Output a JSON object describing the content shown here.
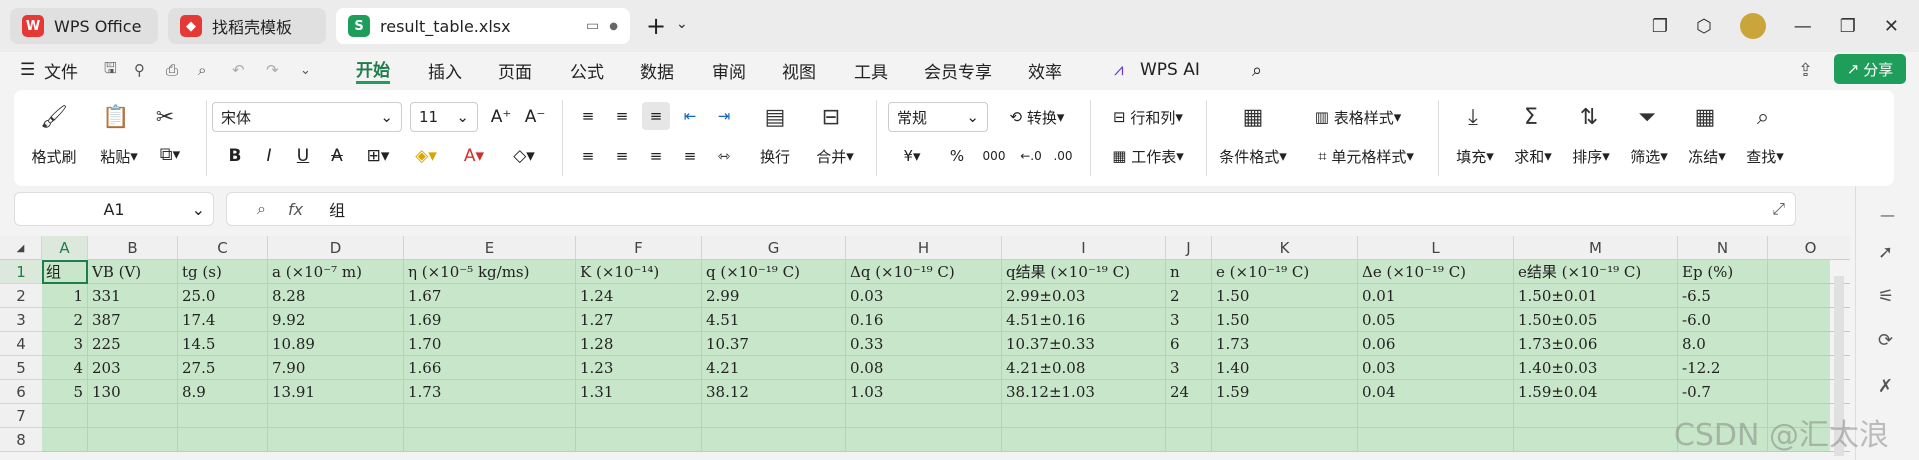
{
  "tabs": [
    {
      "label": "WPS Office"
    },
    {
      "label": "找稻壳模板"
    },
    {
      "label": "result_table.xlsx"
    }
  ],
  "menu": {
    "file": "文件",
    "items": [
      "开始",
      "插入",
      "页面",
      "公式",
      "数据",
      "审阅",
      "视图",
      "工具",
      "会员专享",
      "效率"
    ],
    "wps_ai": "WPS AI",
    "share": "分享"
  },
  "ribbon": {
    "format_painter": "格式刷",
    "paste": "粘贴",
    "font": "宋体",
    "size": "11",
    "number_format": "常规",
    "convert": "转换",
    "row_col": "行和列",
    "wrap": "换行",
    "merge": "合并",
    "worksheet": "工作表",
    "cond_format": "条件格式",
    "table_style": "表格样式",
    "cell_style": "单元格样式",
    "fill": "填充",
    "sum": "求和",
    "sort": "排序",
    "filter": "筛选",
    "freeze": "冻结",
    "find": "查找",
    "currency": "¥",
    "percent": "%",
    "thousands": "000"
  },
  "formula_bar": {
    "name_box": "A1",
    "fx": "fx",
    "content": "组"
  },
  "columns": [
    "A",
    "B",
    "C",
    "D",
    "E",
    "F",
    "G",
    "H",
    "I",
    "J",
    "K",
    "L",
    "M",
    "N",
    "O"
  ],
  "rows": [
    [
      "组",
      "VB (V)",
      "tg (s)",
      "a (×10⁻⁷ m)",
      "η (×10⁻⁵ kg/ms)",
      "K (×10⁻¹⁴)",
      "q (×10⁻¹⁹ C)",
      "Δq (×10⁻¹⁹ C)",
      "q结果 (×10⁻¹⁹ C)",
      "n",
      "e (×10⁻¹⁹ C)",
      "Δe (×10⁻¹⁹ C)",
      "e结果 (×10⁻¹⁹ C)",
      "Ep (%)",
      ""
    ],
    [
      "1",
      "331",
      "25.0",
      "8.28",
      "1.67",
      "1.24",
      "2.99",
      "0.03",
      "2.99±0.03",
      "2",
      "1.50",
      "0.01",
      "1.50±0.01",
      "-6.5",
      ""
    ],
    [
      "2",
      "387",
      "17.4",
      "9.92",
      "1.69",
      "1.27",
      "4.51",
      "0.16",
      "4.51±0.16",
      "3",
      "1.50",
      "0.05",
      "1.50±0.05",
      "-6.0",
      ""
    ],
    [
      "3",
      "225",
      "14.5",
      "10.89",
      "1.70",
      "1.28",
      "10.37",
      "0.33",
      "10.37±0.33",
      "6",
      "1.73",
      "0.06",
      "1.73±0.06",
      "8.0",
      ""
    ],
    [
      "4",
      "203",
      "27.5",
      "7.90",
      "1.66",
      "1.23",
      "4.21",
      "0.08",
      "4.21±0.08",
      "3",
      "1.40",
      "0.03",
      "1.40±0.03",
      "-12.2",
      ""
    ],
    [
      "5",
      "130",
      "8.9",
      "13.91",
      "1.73",
      "1.31",
      "38.12",
      "1.03",
      "38.12±1.03",
      "24",
      "1.59",
      "0.04",
      "1.59±0.04",
      "-0.7",
      ""
    ],
    [
      "",
      "",
      "",
      "",
      "",
      "",
      "",
      "",
      "",
      "",
      "",
      "",
      "",
      "",
      ""
    ],
    [
      "",
      "",
      "",
      "",
      "",
      "",
      "",
      "",
      "",
      "",
      "",
      "",
      "",
      "",
      ""
    ]
  ],
  "row_numbers": [
    "1",
    "2",
    "3",
    "4",
    "5",
    "6",
    "7",
    "8"
  ],
  "watermark": "CSDN @汇太浪"
}
